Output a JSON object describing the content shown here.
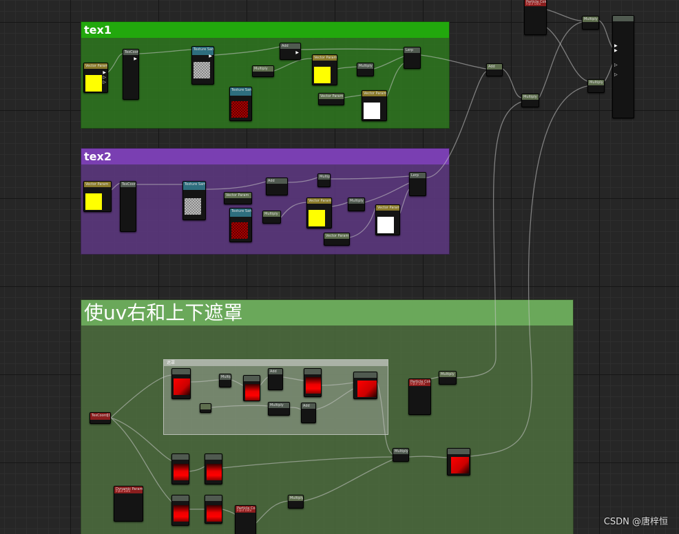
{
  "comments": {
    "tex1": "tex1",
    "tex2": "tex2",
    "mask": "使uv右和上下遮罩",
    "inner": "遮罩"
  },
  "nodes": {
    "particle_color_top": "Particle Color",
    "particle_color_top_sub": "Input Data",
    "particle_color_mid": "Particle Color",
    "particle_color_mid_sub": "Input Data",
    "particle_color_bottom": "Particle Color",
    "particle_color_bottom_sub": "Input Data",
    "dynamic_parameter": "Dynamic Parameter",
    "dynamic_parameter_sub": "Input Data",
    "tex_coord": "TexCoord[0]",
    "multiply": "Multiply",
    "add": "Add",
    "lerp": "Lerp",
    "texture_sample": "Texture Sample",
    "param_color": "Vector Param"
  },
  "pins": {
    "out": "▶",
    "rgb": "▷",
    "empty": "○"
  },
  "watermark": "CSDN @唐梓恒",
  "colors": {
    "tex1_header": "#22a80d",
    "tex2_header": "#7a3fb2",
    "mask_header": "#6aa85a",
    "wire": "#c8c8c8",
    "preview_yellow": "#ffff00",
    "preview_red": "#ff0000"
  }
}
